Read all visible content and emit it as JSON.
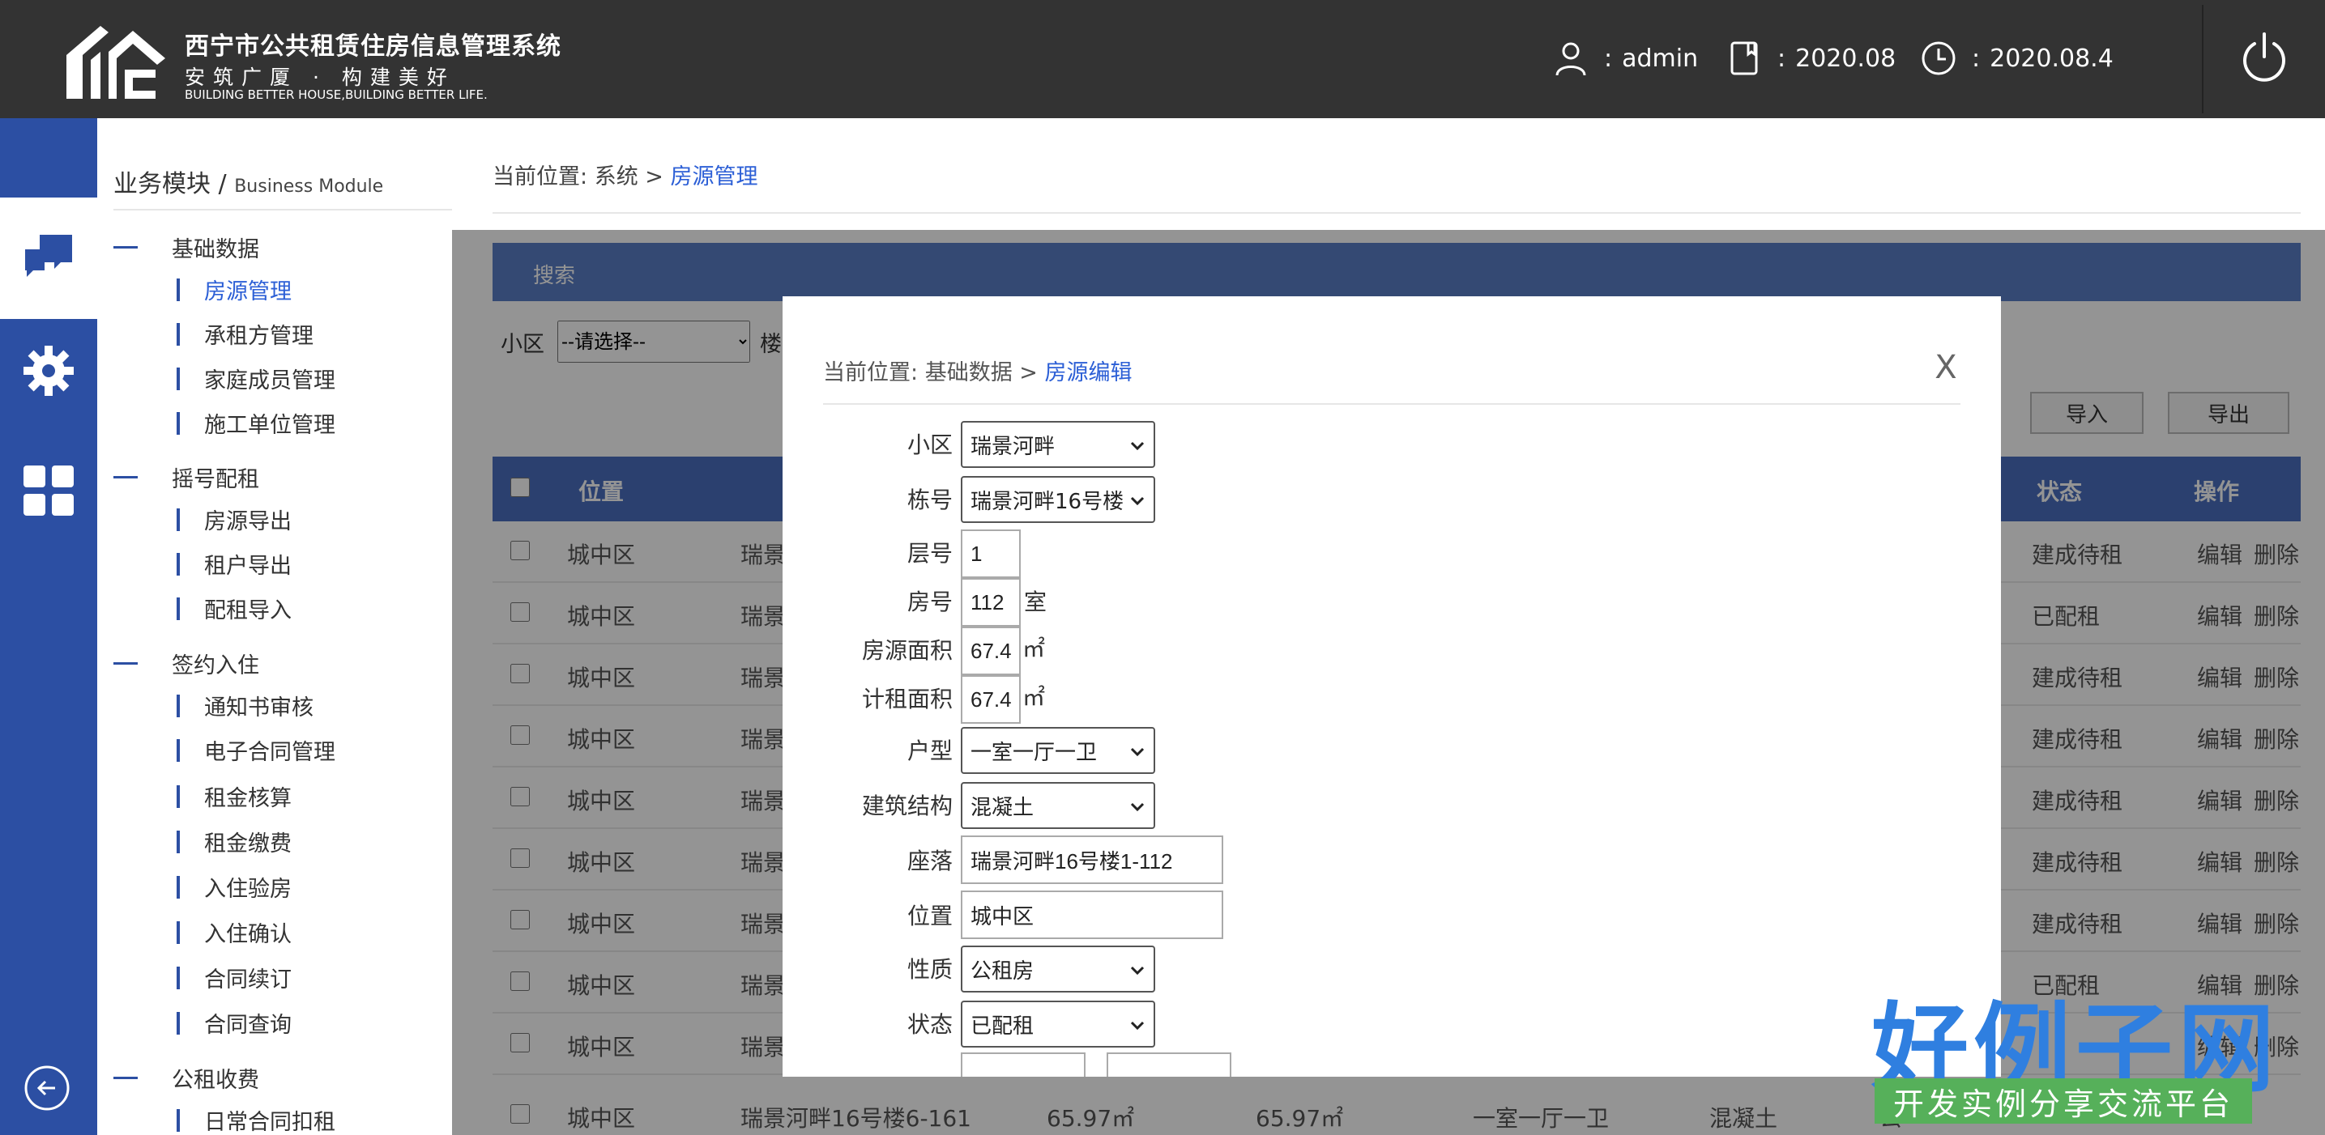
{
  "app": {
    "title_cn": "西宁市公共租赁住房信息管理系统",
    "slogan": "安筑广厦 · 构建美好",
    "slogan_en": "BUILDING BETTER HOUSE,BUILDING BETTER LIFE."
  },
  "header": {
    "user": "admin",
    "period": "2020.08",
    "date": "2020.08.4",
    "colon": ":"
  },
  "menu": {
    "title": "业务模块 /",
    "title_en": "Business Module",
    "groups": [
      {
        "label": "基础数据",
        "items": [
          "房源管理",
          "承租方管理",
          "家庭成员管理",
          "施工单位管理"
        ]
      },
      {
        "label": "摇号配租",
        "items": [
          "房源导出",
          "租户导出",
          "配租导入"
        ]
      },
      {
        "label": "签约入住",
        "items": [
          "通知书审核",
          "电子合同管理",
          "租金核算",
          "租金缴费",
          "入住验房",
          "入住确认",
          "合同续订",
          "合同查询"
        ]
      },
      {
        "label": "公租收费",
        "items": [
          "日常合同扣租"
        ]
      }
    ]
  },
  "main": {
    "crumb_prefix": "当前位置:",
    "crumb_path": "系统 >",
    "crumb_current": "房源管理",
    "search_title": "搜索",
    "filter_label": "小区",
    "filter_placeholder": "--请选择--",
    "filter_next": "楼",
    "import_btn": "导入",
    "export_btn": "导出",
    "columns": {
      "location": "位置",
      "status": "状态",
      "ops": "操作"
    },
    "rows": [
      {
        "loc": "城中区",
        "name": "瑞景",
        "status": "建成待租"
      },
      {
        "loc": "城中区",
        "name": "瑞景",
        "status": "已配租"
      },
      {
        "loc": "城中区",
        "name": "瑞景",
        "status": "建成待租"
      },
      {
        "loc": "城中区",
        "name": "瑞景",
        "status": "建成待租"
      },
      {
        "loc": "城中区",
        "name": "瑞景",
        "status": "建成待租"
      },
      {
        "loc": "城中区",
        "name": "瑞景",
        "status": "建成待租"
      },
      {
        "loc": "城中区",
        "name": "瑞景",
        "status": "建成待租"
      },
      {
        "loc": "城中区",
        "name": "瑞景",
        "status": "已配租"
      },
      {
        "loc": "城中区",
        "name": "瑞景",
        "status": ""
      }
    ],
    "last_row": {
      "loc": "城中区",
      "name": "瑞景河畔16号楼6-161",
      "area1": "65.97㎡",
      "area2": "65.97㎡",
      "type": "一室一厅一卫",
      "struct": "混凝土",
      "nature": "公"
    },
    "edit": "编辑",
    "delete": "删除"
  },
  "modal": {
    "crumb_prefix": "当前位置:",
    "crumb_path": "基础数据 >",
    "crumb_current": "房源编辑",
    "close": "X",
    "fields": {
      "community": {
        "label": "小区",
        "value": "瑞景河畔"
      },
      "building": {
        "label": "栋号",
        "value": "瑞景河畔16号楼"
      },
      "floor": {
        "label": "层号",
        "value": "1"
      },
      "room": {
        "label": "房号",
        "value": "112",
        "unit": "室"
      },
      "area": {
        "label": "房源面积",
        "value": "67.4",
        "unit": "㎡"
      },
      "rent_area": {
        "label": "计租面积",
        "value": "67.4",
        "unit": "㎡"
      },
      "layout": {
        "label": "户型",
        "value": "一室一厅一卫"
      },
      "structure": {
        "label": "建筑结构",
        "value": "混凝土"
      },
      "address": {
        "label": "座落",
        "value": "瑞景河畔16号楼1-112"
      },
      "position": {
        "label": "位置",
        "value": "城中区"
      },
      "nature": {
        "label": "性质",
        "value": "公租房"
      },
      "status": {
        "label": "状态",
        "value": "已配租"
      }
    }
  },
  "watermark": {
    "title": "好例子网",
    "subtitle": "开发实例分享交流平台"
  },
  "colors": {
    "header_bg": "#333333",
    "primary": "#2c4fa3",
    "accent_link": "#2c5fd6",
    "table_head": "#4a6fbf"
  }
}
